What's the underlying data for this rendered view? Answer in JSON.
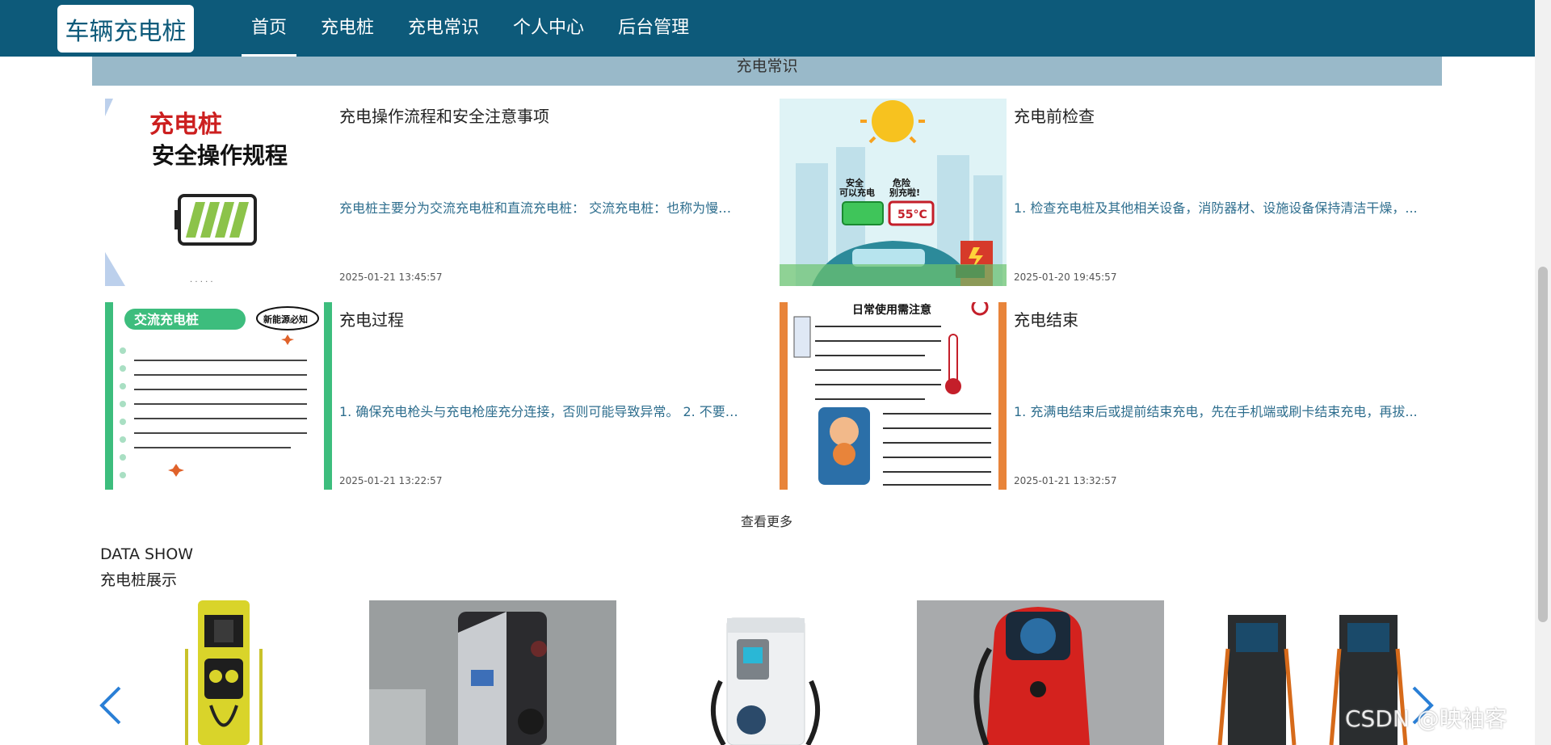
{
  "header": {
    "logo": "车辆充电桩",
    "nav": [
      "首页",
      "充电桩",
      "充电常识",
      "个人中心",
      "后台管理"
    ],
    "active_index": 0
  },
  "knowledge": {
    "section_title": "充电常识",
    "articles": [
      {
        "title": "充电操作流程和安全注意事项",
        "summary": "充电桩主要分为交流充电桩和直流充电桩： 交流充电桩：也称为慢充...",
        "date": "2025-01-21 13:45:57",
        "thumb": {
          "line1": "充电桩",
          "line2": "安全操作规程"
        }
      },
      {
        "title": "充电前检查",
        "summary": "1. 检查充电桩及其他相关设备，消防器材、设施设备保持清洁干燥，...",
        "date": "2025-01-20 19:45:57",
        "thumb": {
          "left_label": "安全\n可以充电",
          "right_label": "危险\n别充啦!",
          "temp": "55°C"
        }
      },
      {
        "title": "充电过程",
        "summary": "1. 确保充电枪头与充电枪座充分连接，否则可能导致异常。 2. 不要采...",
        "date": "2025-01-21 13:22:57",
        "thumb": {
          "tag": "交流充电桩",
          "badge": "新能源必知"
        }
      },
      {
        "title": "充电结束",
        "summary": "1. 充满电结束后或提前结束充电，先在手机端或刷卡结束充电，再拔...",
        "date": "2025-01-21 13:32:57",
        "thumb": {
          "heading": "日常使用需注意"
        }
      }
    ],
    "more_label": "查看更多"
  },
  "data_show": {
    "label_en": "DATA SHOW",
    "label_cn": "充电桩展示",
    "prev_icon": "chevron-left-icon",
    "next_icon": "chevron-right-icon"
  },
  "watermark": "CSDN @映袖客",
  "colors": {
    "header_bg": "#0d5a7a",
    "section_bar": "#99b9c9",
    "summary_text": "#2e6e8e",
    "arrow": "#2a7fd6"
  }
}
